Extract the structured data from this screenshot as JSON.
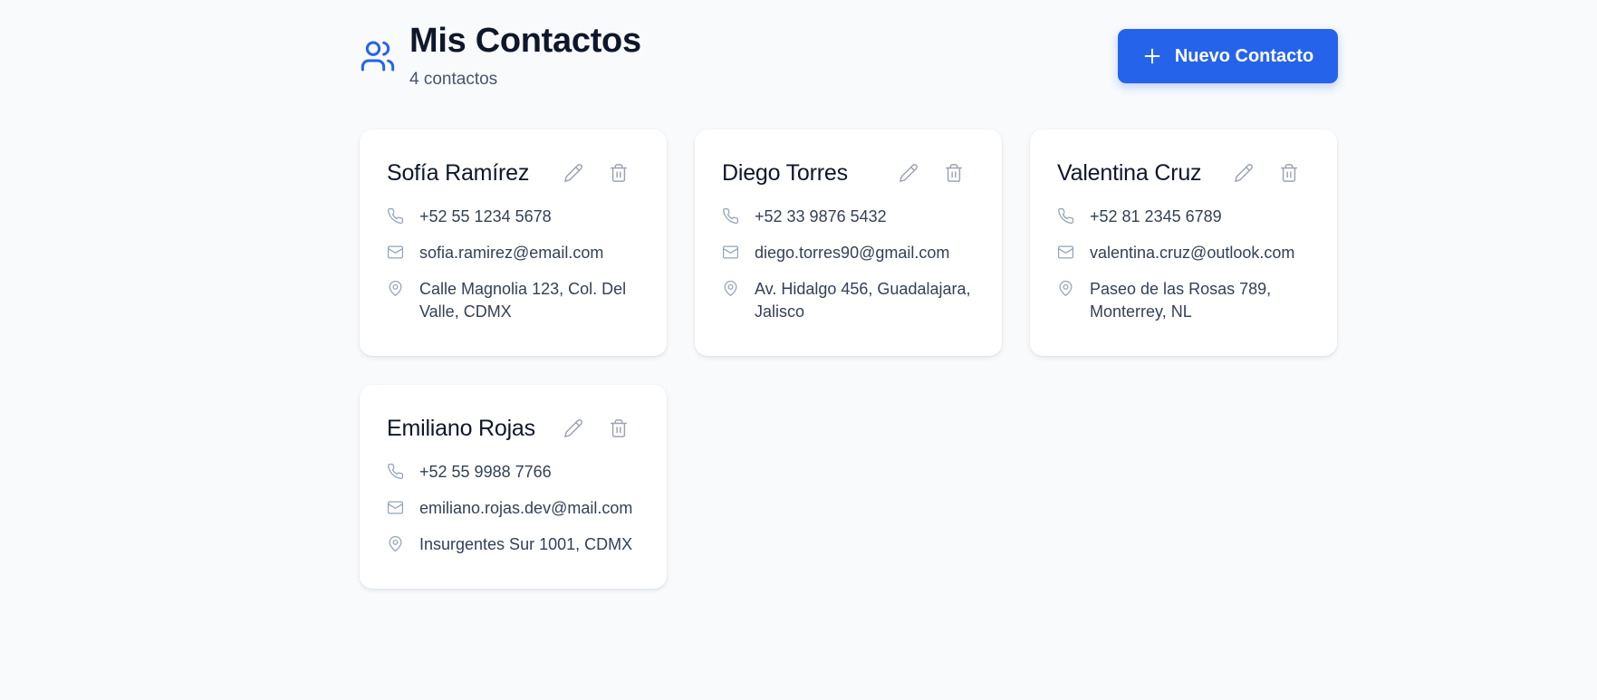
{
  "header": {
    "icon": "users-icon",
    "title": "Mis Contactos",
    "count_text": "4 contactos",
    "new_button_label": "Nuevo Contacto",
    "accent_color": "#2563eb"
  },
  "contacts": [
    {
      "name": "Sofía Ramírez",
      "phone": "+52 55 1234 5678",
      "email": "sofia.ramirez@email.com",
      "address": "Calle Magnolia 123, Col. Del Valle, CDMX"
    },
    {
      "name": "Diego Torres",
      "phone": "+52 33 9876 5432",
      "email": "diego.torres90@gmail.com",
      "address": "Av. Hidalgo 456, Guadalajara, Jalisco"
    },
    {
      "name": "Valentina Cruz",
      "phone": "+52 81 2345 6789",
      "email": "valentina.cruz@outlook.com",
      "address": "Paseo de las Rosas 789, Monterrey, NL"
    },
    {
      "name": "Emiliano Rojas",
      "phone": "+52 55 9988 7766",
      "email": "emiliano.rojas.dev@mail.com",
      "address": "Insurgentes Sur 1001, CDMX"
    }
  ],
  "icons": {
    "edit": "pencil-icon",
    "delete": "trash-icon",
    "phone": "phone-icon",
    "email": "mail-icon",
    "address": "map-pin-icon"
  }
}
